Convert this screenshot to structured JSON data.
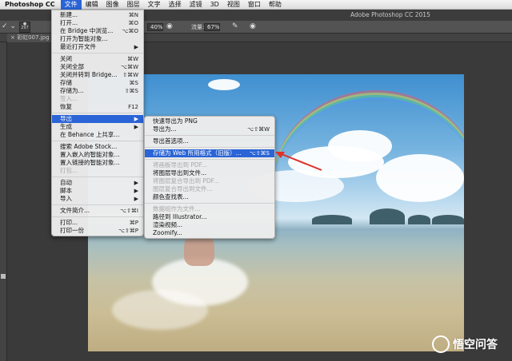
{
  "menubar": {
    "app": "Photoshop CC",
    "items": [
      "文件",
      "编辑",
      "图像",
      "图层",
      "文字",
      "选择",
      "滤镜",
      "3D",
      "视图",
      "窗口",
      "帮助"
    ],
    "active_index": 0
  },
  "titlebar": {
    "title": "Adobe Photoshop CC 2015"
  },
  "optbar": {
    "brush_size": "297",
    "opacity_value": "40%",
    "flow_label": "流量:",
    "flow_value": "67%"
  },
  "doctab": {
    "label": "彩虹007.jpg @"
  },
  "file_menu": [
    {
      "label": "新建...",
      "shortcut": "⌘N"
    },
    {
      "label": "打开...",
      "shortcut": "⌘O"
    },
    {
      "label": "在 Bridge 中浏览...",
      "shortcut": "⌥⌘O"
    },
    {
      "label": "打开为智能对象...",
      "shortcut": ""
    },
    {
      "label": "最近打开文件",
      "shortcut": "▶"
    },
    {
      "sep": true
    },
    {
      "label": "关闭",
      "shortcut": "⌘W"
    },
    {
      "label": "关闭全部",
      "shortcut": "⌥⌘W"
    },
    {
      "label": "关闭并转到 Bridge...",
      "shortcut": "⇧⌘W"
    },
    {
      "label": "存储",
      "shortcut": "⌘S"
    },
    {
      "label": "存储为...",
      "shortcut": "⇧⌘S"
    },
    {
      "label": "签入...",
      "shortcut": "",
      "disabled": true
    },
    {
      "label": "恢复",
      "shortcut": "F12"
    },
    {
      "sep": true
    },
    {
      "label": "导出",
      "shortcut": "▶",
      "highlight": true
    },
    {
      "label": "生成",
      "shortcut": "▶"
    },
    {
      "label": "在 Behance 上共享...",
      "shortcut": ""
    },
    {
      "sep": true
    },
    {
      "label": "搜索 Adobe Stock...",
      "shortcut": ""
    },
    {
      "label": "置入嵌入的智能对象...",
      "shortcut": ""
    },
    {
      "label": "置入链接的智能对象...",
      "shortcut": ""
    },
    {
      "label": "打包...",
      "shortcut": "",
      "disabled": true
    },
    {
      "sep": true
    },
    {
      "label": "自动",
      "shortcut": "▶"
    },
    {
      "label": "脚本",
      "shortcut": "▶"
    },
    {
      "label": "导入",
      "shortcut": "▶"
    },
    {
      "sep": true
    },
    {
      "label": "文件简介...",
      "shortcut": "⌥⇧⌘I"
    },
    {
      "sep": true
    },
    {
      "label": "打印...",
      "shortcut": "⌘P"
    },
    {
      "label": "打印一份",
      "shortcut": "⌥⇧⌘P"
    }
  ],
  "export_menu": [
    {
      "label": "快速导出为 PNG",
      "shortcut": ""
    },
    {
      "label": "导出为...",
      "shortcut": "⌥⇧⌘W"
    },
    {
      "sep": true
    },
    {
      "label": "导出首选项...",
      "shortcut": ""
    },
    {
      "sep": true
    },
    {
      "label": "存储为 Web 所用格式（旧版）...",
      "shortcut": "⌥⇧⌘S",
      "highlight": true
    },
    {
      "sep": true
    },
    {
      "label": "将画板导出到 PDF...",
      "shortcut": "",
      "disabled": true
    },
    {
      "label": "将图层导出到文件...",
      "shortcut": ""
    },
    {
      "label": "将图层复合导出到 PDF...",
      "shortcut": "",
      "disabled": true
    },
    {
      "label": "图层复合导出到文件...",
      "shortcut": "",
      "disabled": true
    },
    {
      "label": "颜色查找表...",
      "shortcut": ""
    },
    {
      "sep": true
    },
    {
      "label": "数据组作为文件...",
      "shortcut": "",
      "disabled": true
    },
    {
      "label": "路径到 Illustrator...",
      "shortcut": ""
    },
    {
      "label": "渲染视频...",
      "shortcut": ""
    },
    {
      "label": "Zoomify...",
      "shortcut": ""
    }
  ],
  "annotation": {
    "arrow_color": "#e0302a"
  },
  "watermark": {
    "text": "悟空问答"
  }
}
